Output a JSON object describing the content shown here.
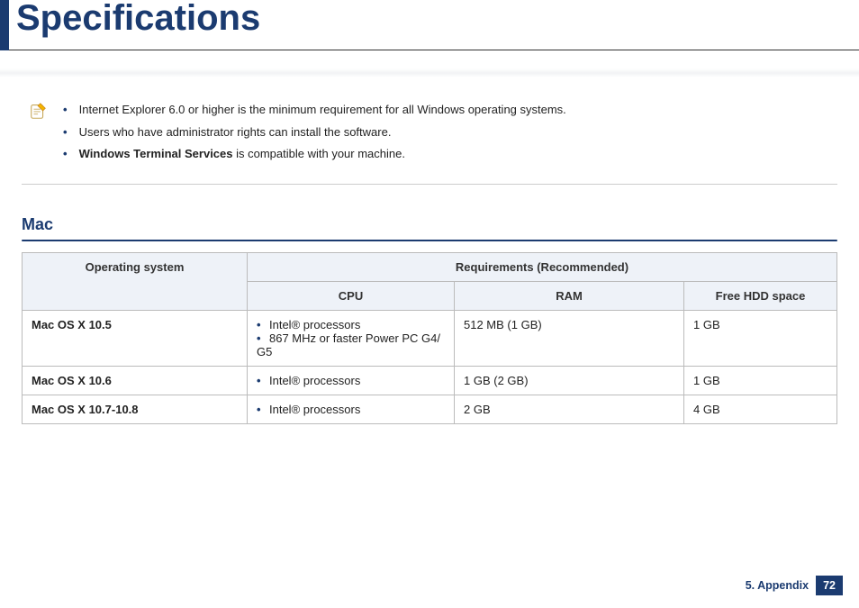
{
  "header": {
    "title": "Specifications"
  },
  "notes": {
    "items": [
      {
        "prefix": "",
        "strong": "",
        "rest": "Internet Explorer 6.0 or higher is the minimum requirement for all Windows operating systems."
      },
      {
        "prefix": "",
        "strong": "",
        "rest": "Users who have administrator rights can install the software."
      },
      {
        "prefix": "",
        "strong": "Windows Terminal Services",
        "rest": " is compatible with your machine."
      }
    ]
  },
  "section": {
    "heading": "Mac"
  },
  "table": {
    "headers": {
      "os": "Operating system",
      "req": "Requirements (Recommended)",
      "cpu": "CPU",
      "ram": "RAM",
      "hdd": "Free HDD space"
    },
    "rows": [
      {
        "os": "Mac OS X 10.5",
        "cpu": [
          "Intel® processors",
          "867 MHz or faster Power PC G4/ G5"
        ],
        "ram": "512 MB (1 GB)",
        "hdd": "1 GB"
      },
      {
        "os": "Mac OS X 10.6",
        "cpu": [
          "Intel® processors"
        ],
        "ram": "1 GB (2 GB)",
        "hdd": "1 GB"
      },
      {
        "os": "Mac OS X 10.7-10.8",
        "cpu": [
          "Intel® processors"
        ],
        "ram": "2 GB",
        "hdd": "4 GB"
      }
    ]
  },
  "footer": {
    "chapter": "5. Appendix",
    "page": "72"
  }
}
